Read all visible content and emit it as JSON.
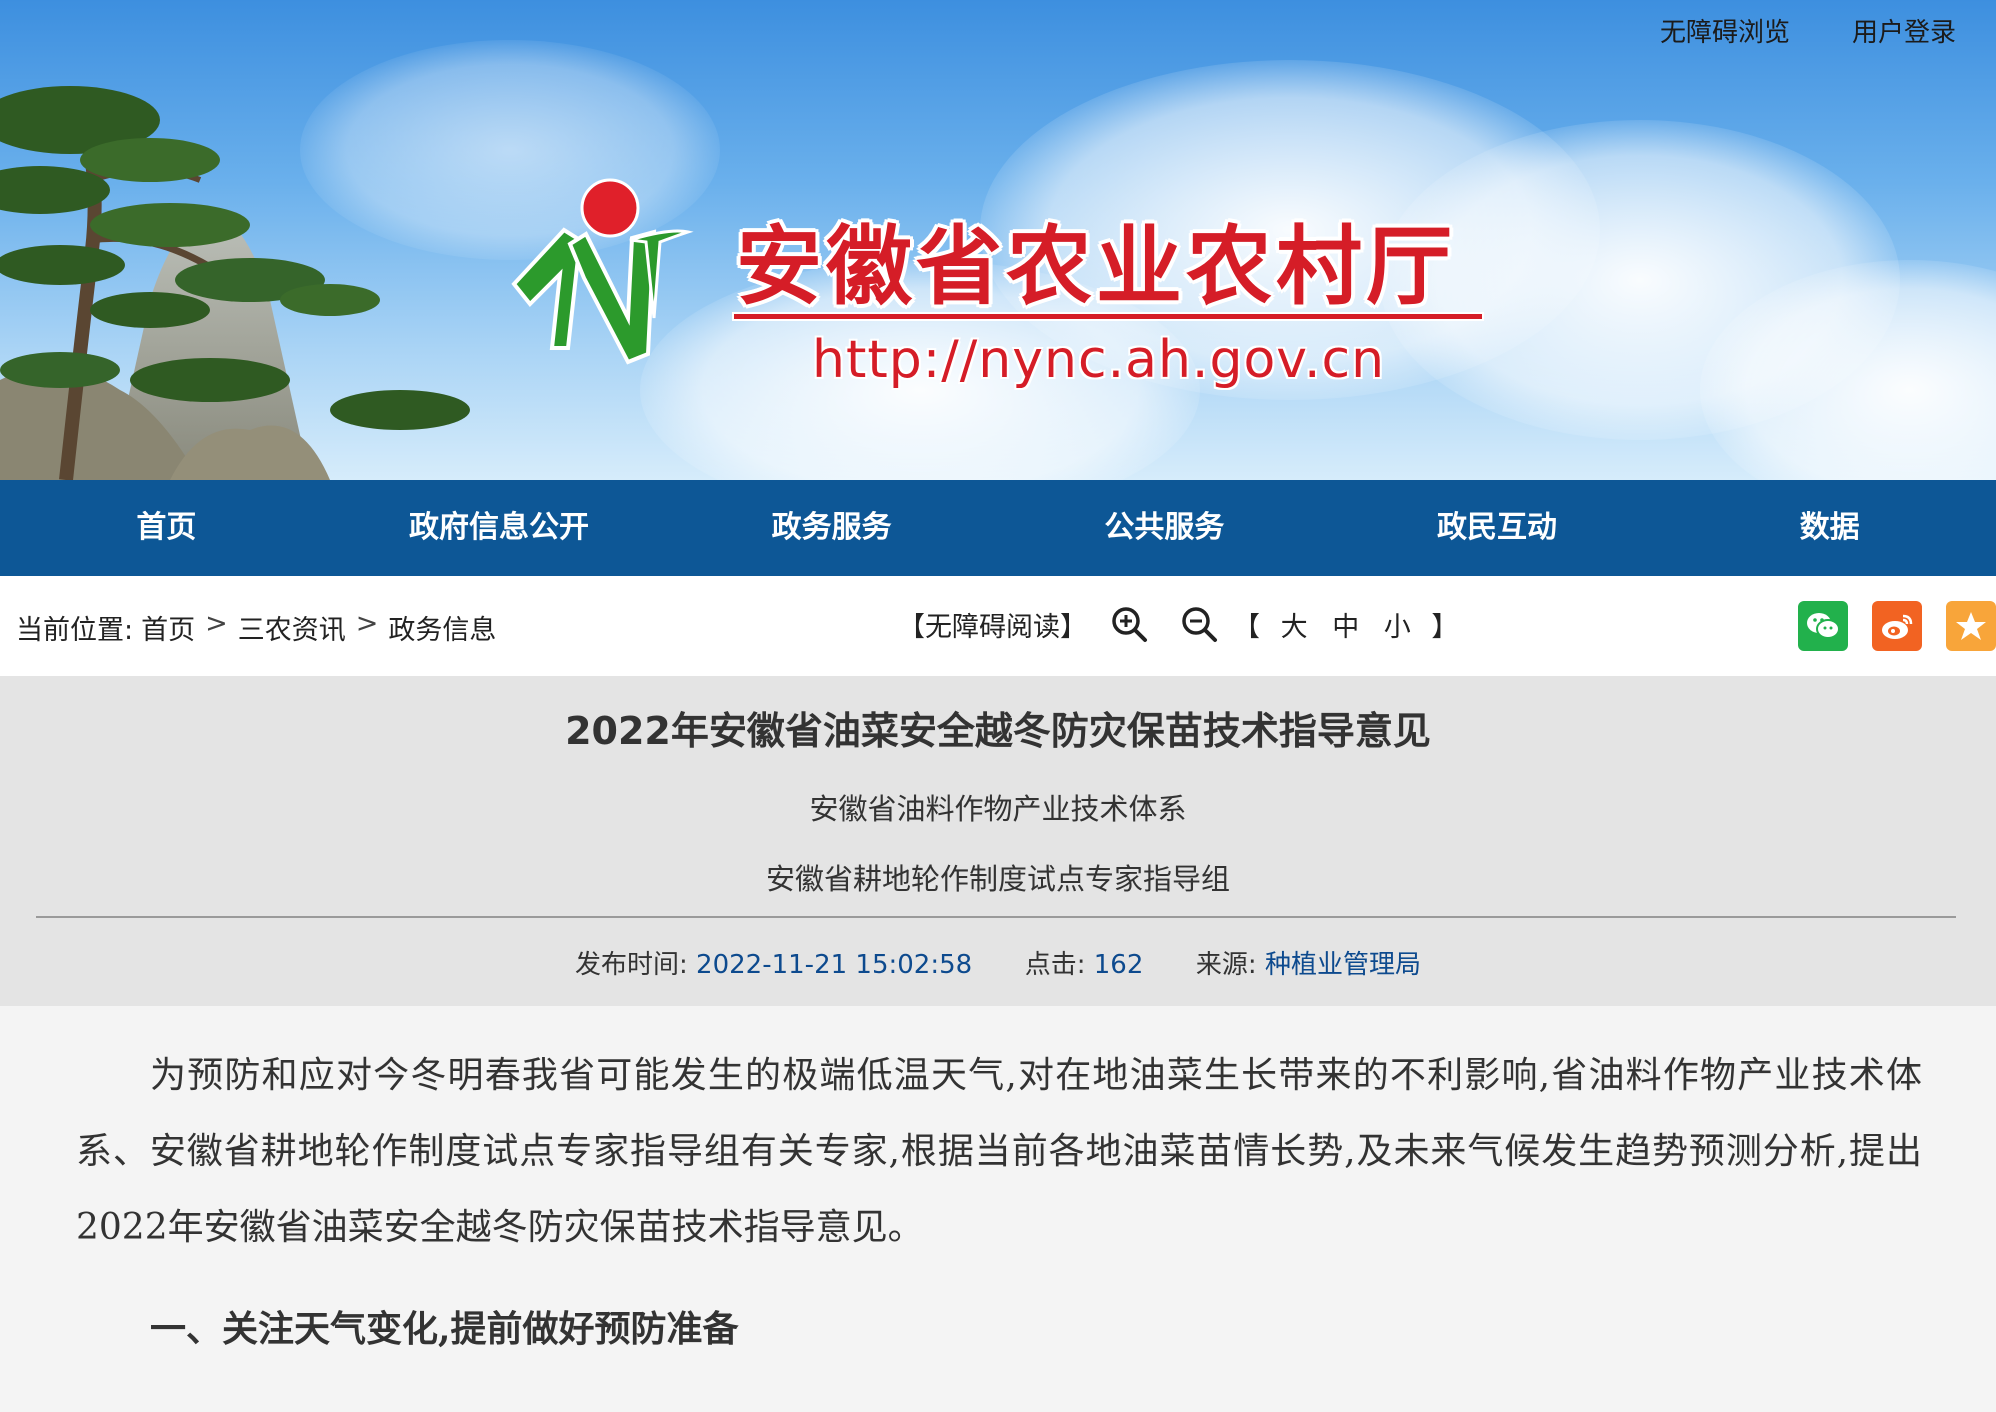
{
  "header": {
    "top_links": [
      "无障碍浏览",
      "用户登录"
    ],
    "site_title": "安徽省农业农村厅",
    "site_url": "http://nync.ah.gov.cn"
  },
  "nav": {
    "items": [
      "首页",
      "政府信息公开",
      "政务服务",
      "公共服务",
      "政民互动",
      "数据"
    ]
  },
  "breadcrumb": {
    "prefix": "当前位置:",
    "items": [
      "首页",
      "三农资讯",
      "政务信息"
    ],
    "separator": ">"
  },
  "a11y": {
    "read_label": "【无障碍阅读】",
    "zoom_in_icon": "zoom-in-icon",
    "zoom_out_icon": "zoom-out-icon",
    "size_open": "【",
    "sizes": [
      "大",
      "中",
      "小"
    ],
    "size_close": "】"
  },
  "share": [
    {
      "icon": "wechat-icon",
      "color": "#22b14c"
    },
    {
      "icon": "weibo-icon",
      "color": "#f26322"
    },
    {
      "icon": "star-icon",
      "color": "#f8a53a"
    }
  ],
  "article": {
    "title": "2022年安徽省油菜安全越冬防灾保苗技术指导意见",
    "authors": [
      "安徽省油料作物产业技术体系",
      "安徽省耕地轮作制度试点专家指导组"
    ],
    "meta": {
      "publish_label": "发布时间:",
      "publish_time": "2022-11-21 15:02:58",
      "clicks_label": "点击:",
      "clicks": "162",
      "source_label": "来源:",
      "source": "种植业管理局"
    },
    "paragraph1": "为预防和应对今冬明春我省可能发生的极端低温天气,对在地油菜生长带来的不利影响,省油料作物产业技术体系、安徽省耕地轮作制度试点专家指导组有关专家,根据当前各地油菜苗情长势,及未来气候发生趋势预测分析,提出2022年安徽省油菜安全越冬防灾保苗技术指导意见。",
    "section1_heading": "一、关注天气变化,提前做好预防准备"
  },
  "colors": {
    "brand_red": "#d51d27",
    "nav_blue": "#0d5796",
    "link_blue": "#0d4a8e"
  }
}
